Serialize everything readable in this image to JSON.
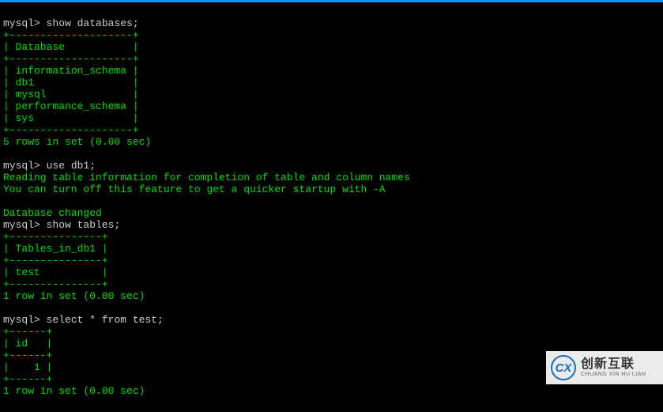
{
  "prompt": "mysql>",
  "sessions": [
    {
      "command": "show databases;",
      "output": [
        "+--------------------+",
        "| Database           |",
        "+--------------------+",
        "| information_schema |",
        "| db1                |",
        "| mysql              |",
        "| performance_schema |",
        "| sys                |",
        "+--------------------+",
        "5 rows in set (0.00 sec)",
        ""
      ]
    },
    {
      "command": "use db1;",
      "output": [
        "Reading table information for completion of table and column names",
        "You can turn off this feature to get a quicker startup with -A",
        "",
        "Database changed"
      ]
    },
    {
      "command": "show tables;",
      "output": [
        "+---------------+",
        "| Tables_in_db1 |",
        "+---------------+",
        "| test          |",
        "+---------------+",
        "1 row in set (0.00 sec)",
        ""
      ]
    },
    {
      "command": "select * from test;",
      "output": [
        "+------+",
        "| id   |",
        "+------+",
        "|    1 |",
        "+------+",
        "1 row in set (0.00 sec)",
        ""
      ]
    }
  ],
  "watermark": {
    "icon_text": "CX",
    "cn": "创新互联",
    "en": "CHUANG XIN HU LIAN"
  }
}
